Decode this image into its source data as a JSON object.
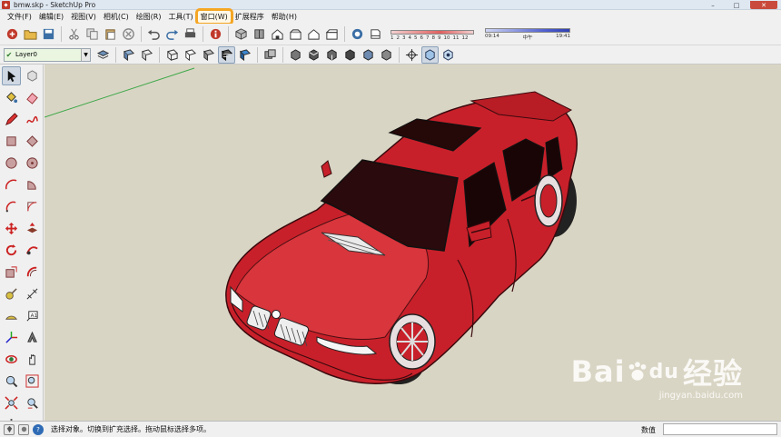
{
  "window": {
    "title": "bmw.skp - SketchUp Pro"
  },
  "window_controls": {
    "minimize": "–",
    "maximize": "□",
    "close": "✕"
  },
  "menu": [
    {
      "label": "文件(F)"
    },
    {
      "label": "编辑(E)"
    },
    {
      "label": "视图(V)"
    },
    {
      "label": "相机(C)"
    },
    {
      "label": "绘图(R)"
    },
    {
      "label": "工具(T)"
    },
    {
      "label": "窗口(W)",
      "highlighted": true
    },
    {
      "label": "扩展程序"
    },
    {
      "label": "帮助(H)"
    }
  ],
  "toolbar1_icons": [
    "sketchup-logo-icon",
    "open-icon",
    "save-icon",
    "cut-icon",
    "copy-icon",
    "paste-icon",
    "erase-icon",
    "undo-icon",
    "redo-icon",
    "print-icon",
    "model-info-icon",
    "iso-view-icon",
    "top-view-icon",
    "front-view-icon",
    "right-view-icon",
    "back-view-icon",
    "left-view-icon",
    "shadow-toggle-icon",
    "fog-icon"
  ],
  "shadow_panel": {
    "months": [
      "1",
      "2",
      "3",
      "4",
      "5",
      "6",
      "7",
      "8",
      "9",
      "10",
      "11",
      "12"
    ],
    "time_start": "09:14",
    "time_mid": "中午",
    "time_end": "19:41"
  },
  "layer": {
    "current": "Layer0"
  },
  "toolbar2_icons": [
    "layer-manager-icon",
    "xray-icon",
    "back-edges-icon",
    "wireframe-icon",
    "hidden-line-icon",
    "shaded-icon",
    "shaded-textures-icon",
    "monochrome-icon",
    "component-icon",
    "iso-small-icon",
    "top-small-icon",
    "front-small-icon",
    "right-small-icon",
    "back-small-icon",
    "left-small-icon",
    "walk-icon",
    "orbit-icon",
    "pan-icon"
  ],
  "left_tools": [
    "select-icon",
    "make-component-icon",
    "paint-bucket-icon",
    "eraser-icon",
    "pencil-line-icon",
    "freehand-icon",
    "rectangle-icon",
    "rotated-rectangle-icon",
    "circle-icon",
    "polygon-icon",
    "arc-icon",
    "pie-icon",
    "two-point-arc-icon",
    "three-point-arc-icon",
    "move-icon",
    "push-pull-icon",
    "rotate-icon",
    "follow-me-icon",
    "scale-icon",
    "offset-icon",
    "tape-measure-icon",
    "dimension-icon",
    "protractor-icon",
    "text-icon",
    "axes-icon",
    "3d-text-icon",
    "orbit-tool-icon",
    "pan-tool-icon",
    "zoom-icon",
    "zoom-window-icon",
    "zoom-extents-icon",
    "previous-view-icon",
    "position-camera-icon",
    "look-around-icon"
  ],
  "status": {
    "message": "选择对象。切换到扩充选择。拖动鼠标选择多项。",
    "measure_label": "数值",
    "measure_value": ""
  },
  "watermark": {
    "logo_left": "Bai",
    "logo_right": "经验",
    "logo_mid": "du",
    "url": "jingyan.baidu.com"
  },
  "colors": {
    "accent": "#f5a623",
    "car": "#c8202a",
    "viewport": "#d9d5c4"
  }
}
